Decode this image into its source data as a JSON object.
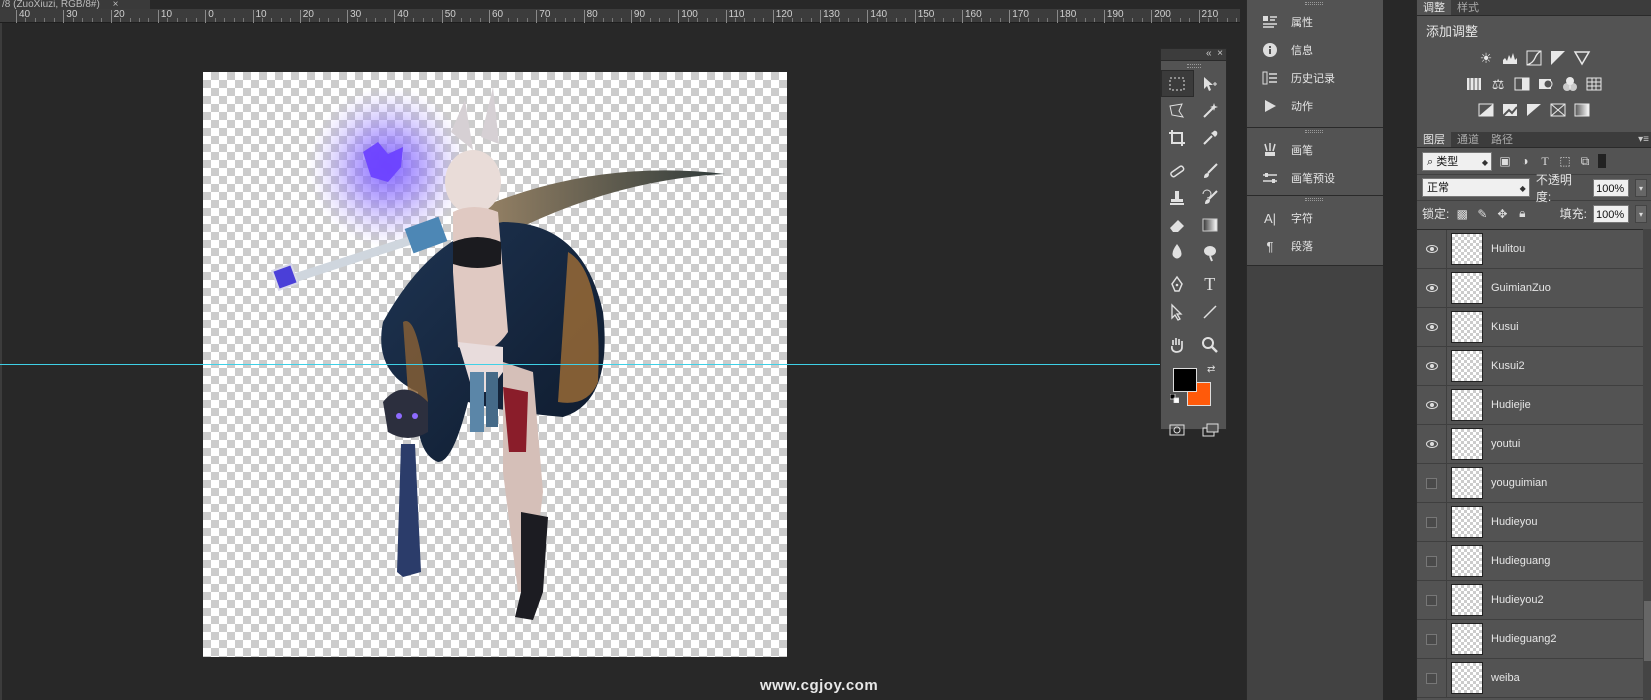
{
  "document": {
    "tab_title": "/8 (ZuoXiuzi, RGB/8#)",
    "close_glyph": "×"
  },
  "ruler": {
    "labels": [
      "40",
      "30",
      "20",
      "10",
      "0",
      "10",
      "20",
      "30",
      "40",
      "50",
      "60",
      "70",
      "80",
      "90",
      "100",
      "110",
      "120",
      "130",
      "140",
      "150",
      "160",
      "170",
      "180",
      "190",
      "200",
      "210"
    ]
  },
  "watermark": "www.cgjoy.com",
  "tools_panel": {
    "collapse_glyph": "«",
    "close_glyph": "×",
    "tools": [
      [
        "rectangular-marquee",
        "move"
      ],
      [
        "lasso",
        "magic-wand"
      ],
      [
        "crop",
        "eyedropper"
      ],
      [
        "healing-brush",
        "brush"
      ],
      [
        "clone-stamp",
        "history-brush"
      ],
      [
        "eraser",
        "gradient"
      ],
      [
        "blur",
        "dodge"
      ],
      [
        "pen",
        "type"
      ],
      [
        "path-selection",
        "line"
      ],
      [
        "hand",
        "zoom"
      ]
    ],
    "type_glyph": "T",
    "foreground_color": "#000000",
    "background_color": "#ff5a0a"
  },
  "mid_panel": {
    "group1": [
      {
        "label": "属性",
        "icon": "properties-icon"
      },
      {
        "label": "信息",
        "icon": "info-icon"
      },
      {
        "label": "历史记录",
        "icon": "history-icon"
      },
      {
        "label": "动作",
        "icon": "actions-icon"
      }
    ],
    "group2": [
      {
        "label": "画笔",
        "icon": "brush-panel-icon"
      },
      {
        "label": "画笔预设",
        "icon": "brush-presets-icon"
      }
    ],
    "group3": [
      {
        "label": "字符",
        "icon": "character-icon"
      },
      {
        "label": "段落",
        "icon": "paragraph-icon"
      }
    ]
  },
  "adjustments": {
    "tabs": [
      "调整",
      "样式"
    ],
    "title": "添加调整"
  },
  "layers_panel": {
    "tabs": [
      "图层",
      "通道",
      "路径"
    ],
    "filter_label": "类型",
    "blend_mode": "正常",
    "opacity_label": "不透明度:",
    "opacity_value": "100%",
    "lock_label": "锁定:",
    "fill_label": "填充:",
    "fill_value": "100%",
    "layers": [
      {
        "name": "Hulitou",
        "visible": true
      },
      {
        "name": "GuimianZuo",
        "visible": true
      },
      {
        "name": "Kusui",
        "visible": true
      },
      {
        "name": "Kusui2",
        "visible": true
      },
      {
        "name": "Hudiejie",
        "visible": true
      },
      {
        "name": "youtui",
        "visible": true
      },
      {
        "name": "youguimian",
        "visible": false
      },
      {
        "name": "Hudieyou",
        "visible": false
      },
      {
        "name": "Hudieguang",
        "visible": false
      },
      {
        "name": "Hudieyou2",
        "visible": false
      },
      {
        "name": "Hudieguang2",
        "visible": false
      },
      {
        "name": "weiba",
        "visible": false
      }
    ]
  },
  "colors": {
    "guide": "#3fd0e6",
    "panel_bg": "#535353",
    "canvas_bg": "#282828"
  }
}
